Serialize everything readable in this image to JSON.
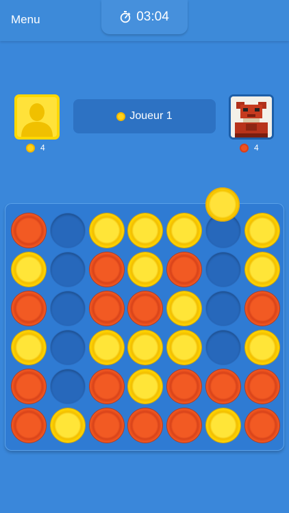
{
  "header": {
    "menu_label": "Menu",
    "timer": "03:04",
    "timer_icon": "stopwatch-icon"
  },
  "players": {
    "p1": {
      "avatar_icon": "person-silhouette-icon",
      "score": "4",
      "color": "yellow"
    },
    "p2": {
      "avatar_icon": "robot-avatar-icon",
      "score": "4",
      "color": "red"
    }
  },
  "turn": {
    "label": "Joueur 1",
    "color": "yellow"
  },
  "colors": {
    "background": "#3a87da",
    "yellow": "#ffd21a",
    "red": "#ef5320",
    "board": "#2f7bd3"
  },
  "board": {
    "columns": 7,
    "rows": 6,
    "drop_column": 6,
    "grid": [
      [
        "R",
        "E",
        "Y",
        "Y",
        "Y",
        "E",
        "Y"
      ],
      [
        "Y",
        "E",
        "R",
        "Y",
        "R",
        "E",
        "Y"
      ],
      [
        "R",
        "E",
        "R",
        "R",
        "Y",
        "E",
        "R"
      ],
      [
        "Y",
        "E",
        "Y",
        "Y",
        "Y",
        "E",
        "Y"
      ],
      [
        "R",
        "E",
        "R",
        "Y",
        "R",
        "R",
        "R"
      ],
      [
        "R",
        "Y",
        "R",
        "R",
        "R",
        "Y",
        "R"
      ]
    ]
  }
}
